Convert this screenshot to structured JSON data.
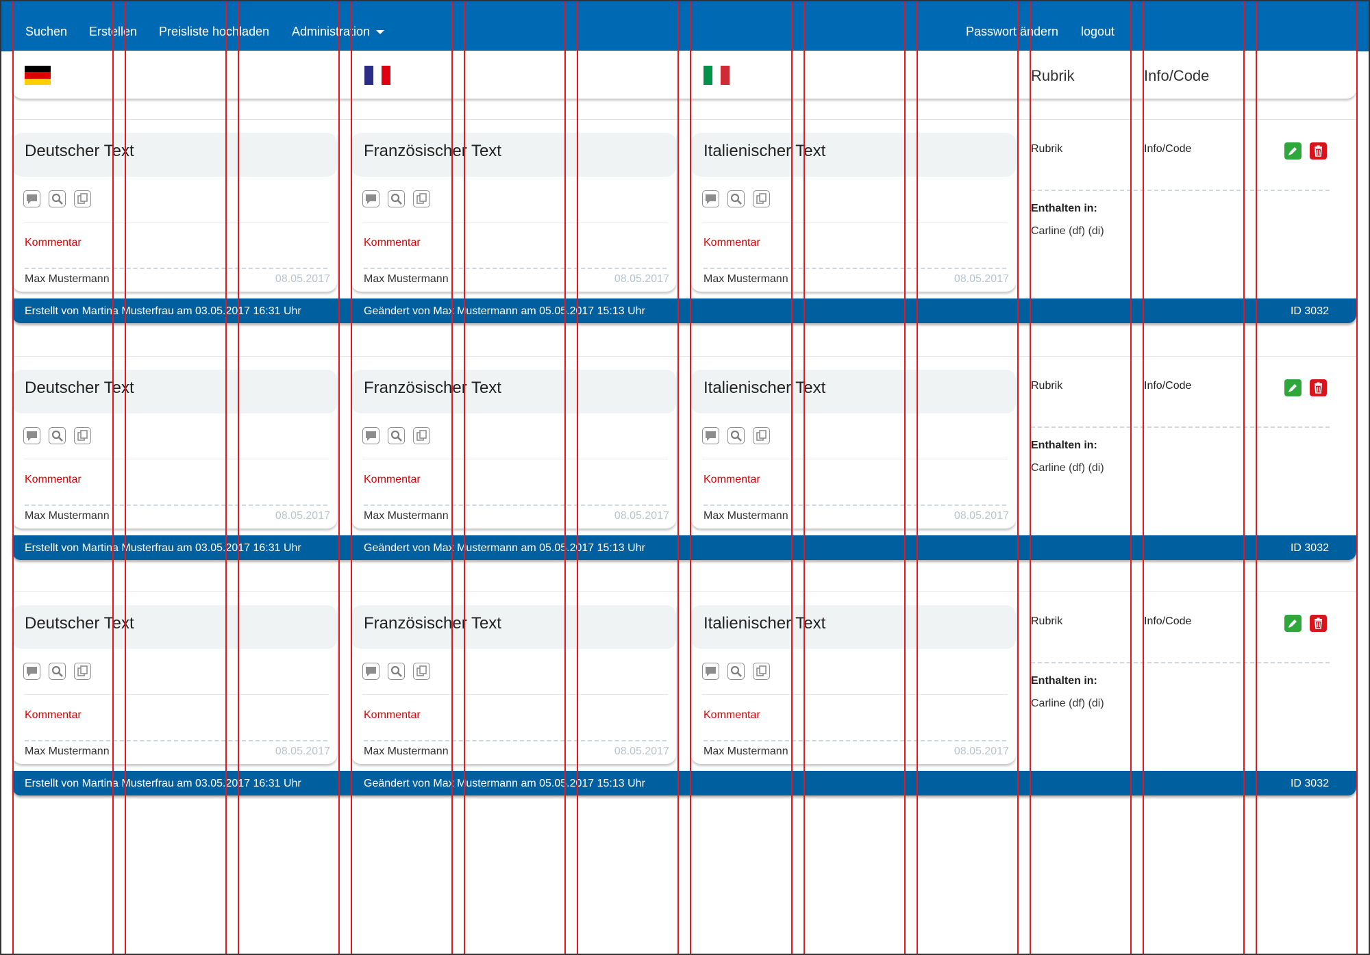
{
  "nav": {
    "left": [
      "Suchen",
      "Erstellen",
      "Preisliste hochladen",
      "Administration"
    ],
    "right": [
      "Passwort ändern",
      "logout"
    ]
  },
  "header": {
    "flags": [
      "german-flag",
      "french-flag",
      "italian-flag"
    ],
    "rubrik_label": "Rubrik",
    "info_label": "Info/Code"
  },
  "records": [
    {
      "cards": [
        {
          "title": "Deutscher Text",
          "comment": "Kommentar",
          "author": "Max Mustermann",
          "date": "08.05.2017"
        },
        {
          "title": "Französischer Text",
          "comment": "Kommentar",
          "author": "Max Mustermann",
          "date": "08.05.2017"
        },
        {
          "title": "Italienischer Text",
          "comment": "Kommentar",
          "author": "Max Mustermann",
          "date": "08.05.2017"
        }
      ],
      "rubrik": "Rubrik",
      "info": "Info/Code",
      "contained_label": "Enthalten in:",
      "contained_value": "Carline (df) (di)",
      "created": "Erstellt von Martina Musterfrau am 03.05.2017 16:31 Uhr",
      "changed": "Geändert von Max Mustermann am 05.05.2017 15:13 Uhr",
      "id": "ID 3032"
    },
    {
      "cards": [
        {
          "title": "Deutscher Text",
          "comment": "Kommentar",
          "author": "Max Mustermann",
          "date": "08.05.2017"
        },
        {
          "title": "Französischer Text",
          "comment": "Kommentar",
          "author": "Max Mustermann",
          "date": "08.05.2017"
        },
        {
          "title": "Italienischer Text",
          "comment": "Kommentar",
          "author": "Max Mustermann",
          "date": "08.05.2017"
        }
      ],
      "rubrik": "Rubrik",
      "info": "Info/Code",
      "contained_label": "Enthalten in:",
      "contained_value": "Carline (df) (di)",
      "created": "Erstellt von Martina Musterfrau am 03.05.2017 16:31 Uhr",
      "changed": "Geändert von Max Mustermann am 05.05.2017 15:13 Uhr",
      "id": "ID 3032"
    },
    {
      "cards": [
        {
          "title": "Deutscher Text",
          "comment": "Kommentar",
          "author": "Max Mustermann",
          "date": "08.05.2017"
        },
        {
          "title": "Französischer Text",
          "comment": "Kommentar",
          "author": "Max Mustermann",
          "date": "08.05.2017"
        },
        {
          "title": "Italienischer Text",
          "comment": "Kommentar",
          "author": "Max Mustermann",
          "date": "08.05.2017"
        }
      ],
      "rubrik": "Rubrik",
      "info": "Info/Code",
      "contained_label": "Enthalten in:",
      "contained_value": "Carline (df) (di)",
      "created": "Erstellt von Martina Musterfrau am 03.05.2017 16:31 Uhr",
      "changed": "Geändert von Max Mustermann am 05.05.2017 15:13 Uhr",
      "id": "ID 3032"
    }
  ],
  "card_tools": [
    "comment-icon",
    "search-icon",
    "copy-icon"
  ],
  "row_actions": [
    "edit-icon",
    "trash-icon"
  ],
  "colors": {
    "navbar": "#0069b4",
    "footer": "#00609f",
    "comment": "#e10000",
    "edit": "#2ea83a",
    "delete": "#d9141b",
    "guide": "#e6161c"
  }
}
